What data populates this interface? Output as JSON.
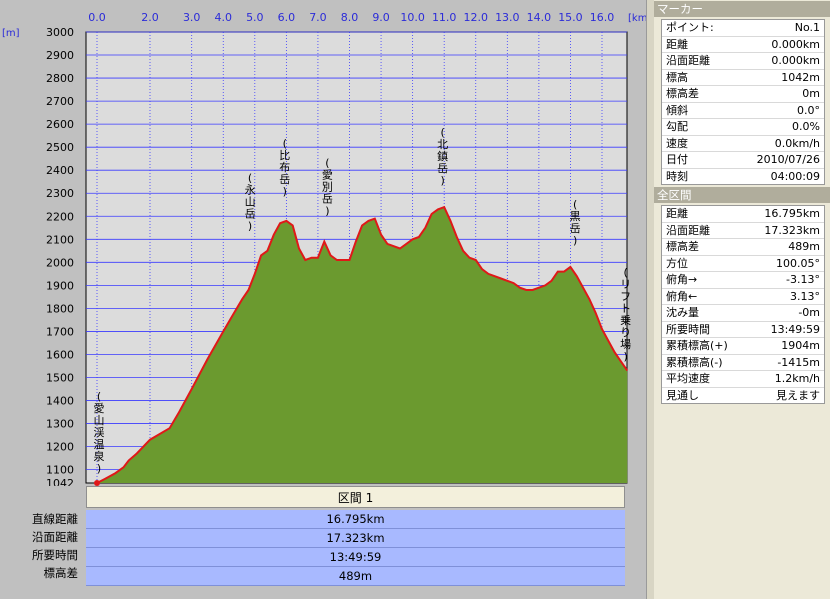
{
  "colors": {
    "fill": "#6b9a2f",
    "line": "#e01818",
    "grid": "#3a3aff",
    "plot_bg": "#dcdcdc",
    "axis_text": "#2b2bd8"
  },
  "chart_data": {
    "type": "area",
    "x_unit": "[km]",
    "y_unit": "[m]",
    "xlim": [
      0,
      16.8
    ],
    "ylim": [
      1042,
      3000
    ],
    "x_ticks": [
      0,
      2,
      3,
      4,
      5,
      6,
      7,
      8,
      9,
      10,
      11,
      12,
      13,
      14,
      15,
      16
    ],
    "x_tick_labels": [
      "0.0",
      "2.0",
      "3.0",
      "4.0",
      "5.0",
      "6.0",
      "7.0",
      "8.0",
      "9.0",
      "10.0",
      "11.0",
      "12.0",
      "13.0",
      "14.0",
      "15.0",
      "16.0"
    ],
    "y_ticks": [
      1042,
      1100,
      1200,
      1300,
      1400,
      1500,
      1600,
      1700,
      1800,
      1900,
      2000,
      2100,
      2200,
      2300,
      2400,
      2500,
      2600,
      2700,
      2800,
      2900,
      3000
    ],
    "y_tick_labels": [
      "1042",
      "1100",
      "1200",
      "1300",
      "1400",
      "1500",
      "1600",
      "1700",
      "1800",
      "1900",
      "2000",
      "2100",
      "2200",
      "2300",
      "2400",
      "2500",
      "2600",
      "2700",
      "2800",
      "2900",
      "3000"
    ],
    "x": [
      0,
      0.3,
      0.7,
      1.0,
      1.2,
      1.5,
      2.0,
      2.3,
      2.6,
      3.0,
      3.5,
      4.0,
      4.3,
      4.6,
      4.8,
      5.0,
      5.2,
      5.4,
      5.6,
      5.8,
      6.0,
      6.2,
      6.4,
      6.6,
      6.8,
      7.0,
      7.2,
      7.4,
      7.6,
      7.8,
      8.0,
      8.2,
      8.4,
      8.6,
      8.8,
      9.0,
      9.2,
      9.4,
      9.6,
      9.8,
      10.0,
      10.2,
      10.4,
      10.6,
      10.8,
      11.0,
      11.2,
      11.4,
      11.6,
      11.8,
      12.0,
      12.2,
      12.4,
      12.6,
      12.8,
      13.0,
      13.2,
      13.4,
      13.6,
      13.8,
      14.0,
      14.2,
      14.4,
      14.6,
      14.8,
      15.0,
      15.2,
      15.4,
      15.6,
      15.8,
      16.0,
      16.2,
      16.4,
      16.6,
      16.8
    ],
    "y": [
      1042,
      1060,
      1085,
      1110,
      1140,
      1170,
      1230,
      1280,
      1350,
      1450,
      1580,
      1700,
      1770,
      1840,
      1880,
      1950,
      2030,
      2050,
      2120,
      2170,
      2180,
      2160,
      2060,
      2010,
      2020,
      2020,
      2090,
      2030,
      2010,
      2010,
      2010,
      2090,
      2160,
      2180,
      2190,
      2120,
      2080,
      2070,
      2060,
      2080,
      2100,
      2110,
      2150,
      2210,
      2230,
      2240,
      2180,
      2110,
      2050,
      2020,
      2010,
      1970,
      1950,
      1940,
      1930,
      1920,
      1910,
      1890,
      1880,
      1880,
      1890,
      1900,
      1920,
      1960,
      1960,
      1980,
      1940,
      1890,
      1840,
      1780,
      1710,
      1660,
      1610,
      1570,
      1530
    ],
    "peaks": [
      {
        "label": "(愛山渓温泉)",
        "x": 0.0,
        "y": 1042
      },
      {
        "label": "(永山岳)",
        "x": 4.85,
        "y": 2046
      },
      {
        "label": "(比布岳)",
        "x": 5.95,
        "y": 2197
      },
      {
        "label": "(愛別岳)",
        "x": 7.3,
        "y": 2112
      },
      {
        "label": "(北鎮岳)",
        "x": 10.95,
        "y": 2244
      },
      {
        "label": "(黒岳)",
        "x": 15.15,
        "y": 1984
      },
      {
        "label": "(リフト乗り場)",
        "x": 16.75,
        "y": 1520
      }
    ]
  },
  "summary": {
    "header": "区間 1",
    "rows": [
      {
        "label": "直線距離",
        "value": "16.795km"
      },
      {
        "label": "沿面距離",
        "value": "17.323km"
      },
      {
        "label": "所要時間",
        "value": "13:49:59"
      },
      {
        "label": "標高差",
        "value": "489m"
      }
    ]
  },
  "marker_panel": {
    "title": "マーカー",
    "rows": [
      {
        "label": "ポイント:",
        "value": "No.1"
      },
      {
        "label": "距離",
        "value": "0.000km"
      },
      {
        "label": "沿面距離",
        "value": "0.000km"
      },
      {
        "label": "標高",
        "value": "1042m"
      },
      {
        "label": "標高差",
        "value": "0m"
      },
      {
        "label": "傾斜",
        "value": "0.0°"
      },
      {
        "label": "勾配",
        "value": "0.0%"
      },
      {
        "label": "速度",
        "value": "0.0km/h"
      },
      {
        "label": "日付",
        "value": "2010/07/26"
      },
      {
        "label": "時刻",
        "value": "04:00:09"
      }
    ]
  },
  "section_panel": {
    "title": "全区間",
    "rows": [
      {
        "label": "距離",
        "value": "16.795km"
      },
      {
        "label": "沿面距離",
        "value": "17.323km"
      },
      {
        "label": "標高差",
        "value": "489m"
      },
      {
        "label": "方位",
        "value": "100.05°"
      },
      {
        "label": "俯角→",
        "value": "-3.13°"
      },
      {
        "label": "俯角←",
        "value": "3.13°"
      },
      {
        "label": "沈み量",
        "value": "-0m"
      },
      {
        "label": "所要時間",
        "value": "13:49:59"
      },
      {
        "label": "累積標高(+)",
        "value": "1904m"
      },
      {
        "label": "累積標高(-)",
        "value": "-1415m"
      },
      {
        "label": "平均速度",
        "value": "1.2km/h"
      },
      {
        "label": "見通し",
        "value": "見えます"
      }
    ]
  }
}
